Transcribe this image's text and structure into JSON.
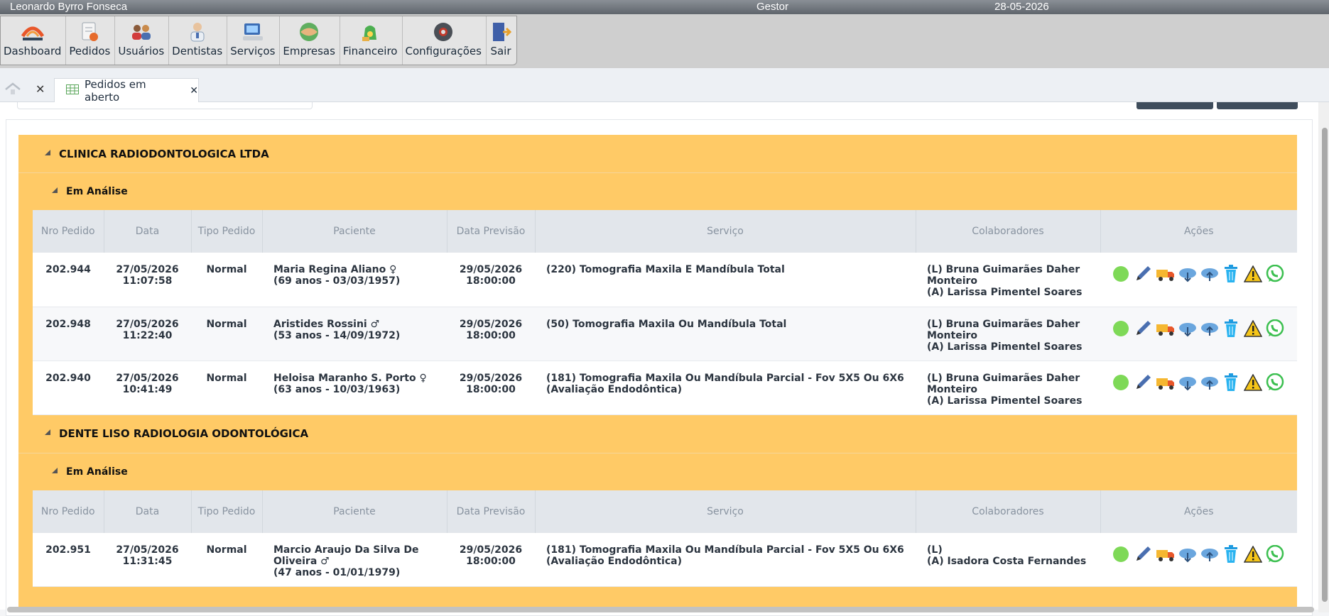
{
  "topbar": {
    "user": "Leonardo Byrro Fonseca",
    "role": "Gestor",
    "date": "28-05-2026"
  },
  "menu": [
    {
      "label": "Dashboard",
      "icon": "dashboard-logo-icon"
    },
    {
      "label": "Pedidos",
      "icon": "orders-icon"
    },
    {
      "label": "Usuários",
      "icon": "users-icon"
    },
    {
      "label": "Dentistas",
      "icon": "dentist-icon"
    },
    {
      "label": "Serviços",
      "icon": "services-icon"
    },
    {
      "label": "Empresas",
      "icon": "companies-icon"
    },
    {
      "label": "Financeiro",
      "icon": "finance-icon"
    },
    {
      "label": "Configurações",
      "icon": "settings-icon"
    },
    {
      "label": "Sair",
      "icon": "exit-icon"
    }
  ],
  "tabs": {
    "active_label": "Pedidos em aberto"
  },
  "columns": [
    "Nro Pedido",
    "Data",
    "Tipo Pedido",
    "Paciente",
    "Data Previsão",
    "Serviço",
    "Colaboradores",
    "Ações"
  ],
  "groups": [
    {
      "company": "CLINICA RADIODONTOLOGICA LTDA",
      "status": "Em Análise",
      "rows": [
        {
          "nro": "202.944",
          "date": "27/05/2026",
          "time": "11:07:58",
          "tipo": "Normal",
          "patient": "Maria Regina Aliano ♀",
          "patient_info": "(69 anos - 03/03/1957)",
          "prev_date": "29/05/2026",
          "prev_time": "18:00:00",
          "service": "(220) Tomografia Maxila E Mandíbula Total",
          "collab_l": "(L) Bruna Guimarães Daher Monteiro",
          "collab_a": "(A) Larissa Pimentel Soares"
        },
        {
          "nro": "202.948",
          "date": "27/05/2026",
          "time": "11:22:40",
          "tipo": "Normal",
          "patient": "Aristides Rossini ♂",
          "patient_info": "(53 anos - 14/09/1972)",
          "prev_date": "29/05/2026",
          "prev_time": "18:00:00",
          "service": "(50) Tomografia Maxila Ou Mandíbula Total",
          "collab_l": "(L) Bruna Guimarães Daher Monteiro",
          "collab_a": "(A) Larissa Pimentel Soares"
        },
        {
          "nro": "202.940",
          "date": "27/05/2026",
          "time": "10:41:49",
          "tipo": "Normal",
          "patient": "Heloisa Maranho S. Porto ♀",
          "patient_info": "(63 anos - 10/03/1963)",
          "prev_date": "29/05/2026",
          "prev_time": "18:00:00",
          "service": "(181) Tomografia Maxila Ou Mandíbula Parcial - Fov 5X5 Ou 6X6 (Avaliação Endodôntica)",
          "collab_l": "(L) Bruna Guimarães Daher Monteiro",
          "collab_a": "(A) Larissa Pimentel Soares"
        }
      ]
    },
    {
      "company": "DENTE LISO RADIOLOGIA ODONTOLÓGICA",
      "status": "Em Análise",
      "rows": [
        {
          "nro": "202.951",
          "date": "27/05/2026",
          "time": "11:31:45",
          "tipo": "Normal",
          "patient": "Marcio Araujo Da Silva De Oliveira ♂",
          "patient_info": "(47 anos - 01/01/1979)",
          "prev_date": "29/05/2026",
          "prev_time": "18:00:00",
          "service": "(181) Tomografia Maxila Ou Mandíbula Parcial - Fov 5X5 Ou 6X6 (Avaliação Endodôntica)",
          "collab_l": "(L)",
          "collab_a": "(A) Isadora Costa Fernandes"
        }
      ]
    }
  ],
  "colors": {
    "group_bg": "#ffca66",
    "header_bg": "#e2e6eb",
    "topbar": "#6b7178"
  }
}
